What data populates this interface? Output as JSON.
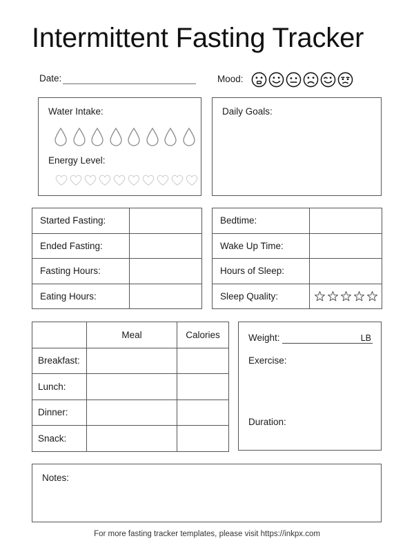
{
  "title": "Intermittent Fasting Tracker",
  "header": {
    "date_label": "Date:",
    "date_value": "",
    "mood_label": "Mood:",
    "mood_faces": [
      "surprised-face-icon",
      "smiling-face-icon",
      "neutral-face-icon",
      "frowning-face-icon",
      "winking-face-icon",
      "unamused-face-icon"
    ]
  },
  "water": {
    "label": "Water Intake:",
    "drop_count": 8,
    "drop_icon": "water-drop-icon",
    "drop_color": "#8a8a8a"
  },
  "energy": {
    "label": "Energy Level:",
    "heart_count": 10,
    "heart_icon": "heart-icon",
    "heart_color": "#cccccc"
  },
  "goals": {
    "label": "Daily Goals:",
    "value": ""
  },
  "fasting_table": {
    "rows": [
      {
        "label": "Started Fasting:",
        "value": ""
      },
      {
        "label": "Ended Fasting:",
        "value": ""
      },
      {
        "label": "Fasting Hours:",
        "value": ""
      },
      {
        "label": "Eating Hours:",
        "value": ""
      }
    ]
  },
  "sleep_table": {
    "rows": [
      {
        "label": "Bedtime:",
        "value": ""
      },
      {
        "label": "Wake Up Time:",
        "value": ""
      },
      {
        "label": "Hours of Sleep:",
        "value": ""
      },
      {
        "label": "Sleep Quality:",
        "value": ""
      }
    ],
    "star_count": 5,
    "star_icon": "star-outline-icon",
    "star_color": "#555555"
  },
  "meal_table": {
    "headers": [
      "",
      "Meal",
      "Calories"
    ],
    "rows": [
      {
        "label": "Breakfast:",
        "meal": "",
        "calories": ""
      },
      {
        "label": "Lunch:",
        "meal": "",
        "calories": ""
      },
      {
        "label": "Dinner:",
        "meal": "",
        "calories": ""
      },
      {
        "label": "Snack:",
        "meal": "",
        "calories": ""
      }
    ]
  },
  "weight_box": {
    "weight_label": "Weight:",
    "weight_value": "",
    "weight_unit": "LB",
    "exercise_label": "Exercise:",
    "exercise_value": "",
    "duration_label": "Duration:",
    "duration_value": ""
  },
  "notes": {
    "label": "Notes:",
    "value": ""
  },
  "footer": {
    "text": "For more fasting tracker templates, please visit https://inkpx.com"
  },
  "colors": {
    "border": "#555555",
    "text": "#1a1a1a",
    "rule": "#6e6e6e"
  }
}
